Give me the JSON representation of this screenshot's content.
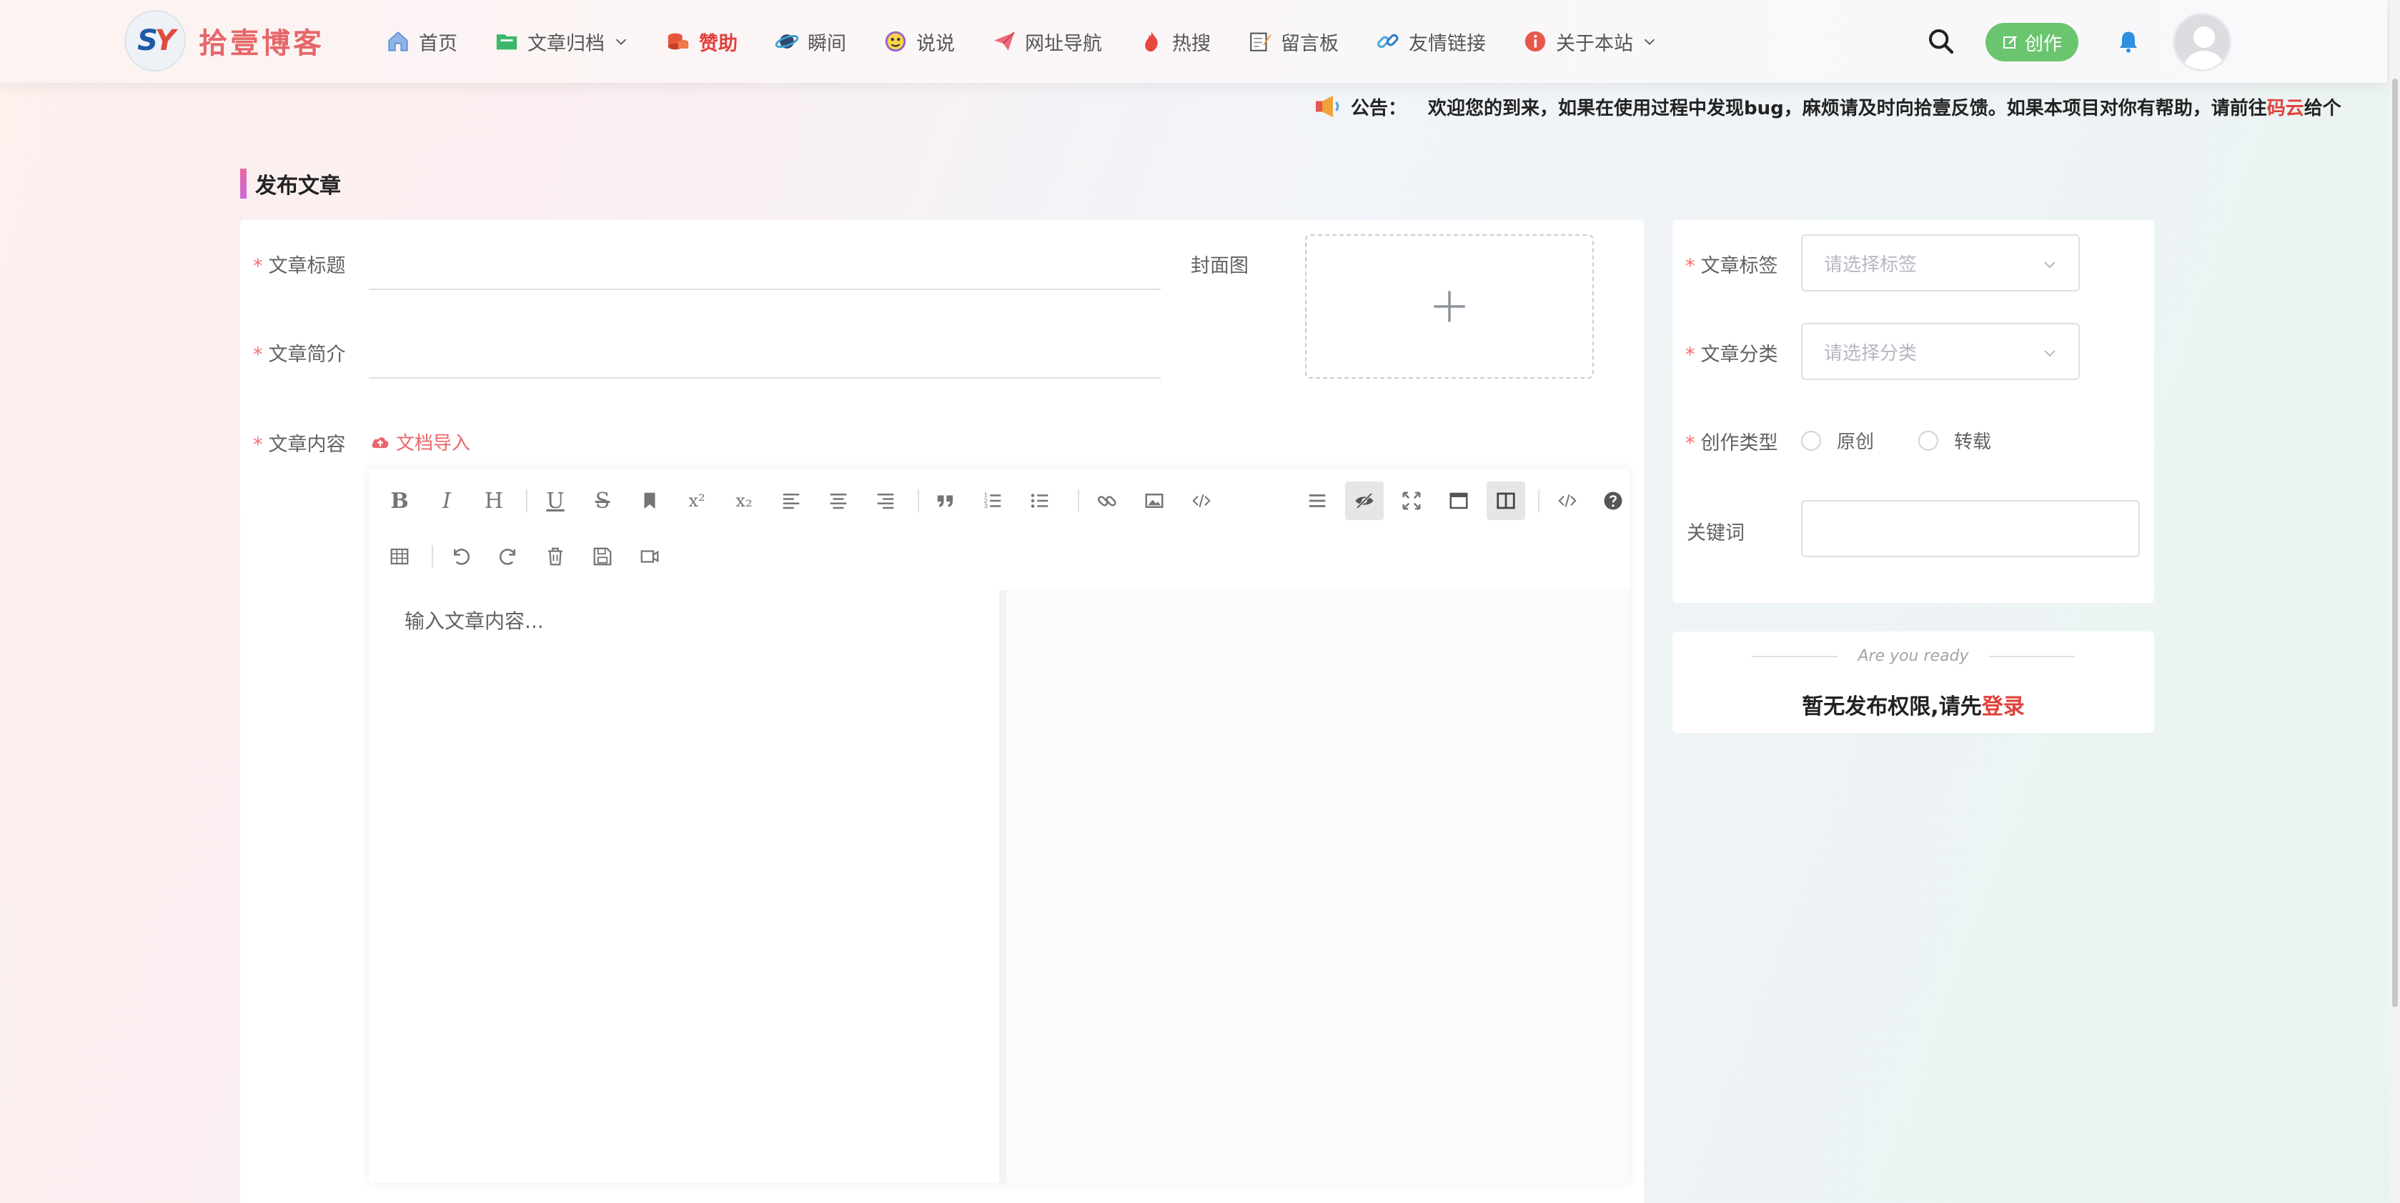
{
  "header": {
    "logo_text": "SY",
    "site_name": "拾壹博客",
    "nav": [
      {
        "label": "首页",
        "icon": "home-icon"
      },
      {
        "label": "文章归档",
        "icon": "folder-icon",
        "has_dropdown": true
      },
      {
        "label": "赞助",
        "icon": "coins-icon",
        "active": true
      },
      {
        "label": "瞬间",
        "icon": "planet-icon"
      },
      {
        "label": "说说",
        "icon": "chat-face-icon"
      },
      {
        "label": "网址导航",
        "icon": "paper-plane-icon"
      },
      {
        "label": "热搜",
        "icon": "fire-icon"
      },
      {
        "label": "留言板",
        "icon": "notepad-icon"
      },
      {
        "label": "友情链接",
        "icon": "link-icon"
      },
      {
        "label": "关于本站",
        "icon": "info-icon",
        "has_dropdown": true
      }
    ],
    "create_label": "创作"
  },
  "notice": {
    "label": "公告：",
    "text": "欢迎您的到来，如果在使用过程中发现bug，麻烦请及时向拾壹反馈。如果本项目对你有帮助，请前往",
    "link": "码云",
    "suffix": "给个"
  },
  "page": {
    "title": "发布文章"
  },
  "form": {
    "title_label": "文章标题",
    "summary_label": "文章简介",
    "cover_label": "封面图",
    "content_label": "文章内容",
    "import_label": "文档导入",
    "editor_placeholder": "输入文章内容..."
  },
  "side": {
    "tag_label": "文章标签",
    "tag_placeholder": "请选择标签",
    "category_label": "文章分类",
    "category_placeholder": "请选择分类",
    "type_label": "创作类型",
    "type_options": [
      "原创",
      "转载"
    ],
    "keyword_label": "关键词"
  },
  "login_card": {
    "ready_text": "Are you ready",
    "message": "暂无发布权限,请先",
    "login_link": "登录"
  },
  "colors": {
    "accent": "#e0413b",
    "brand": "#e6676b",
    "create_button": "#6bc56f"
  }
}
